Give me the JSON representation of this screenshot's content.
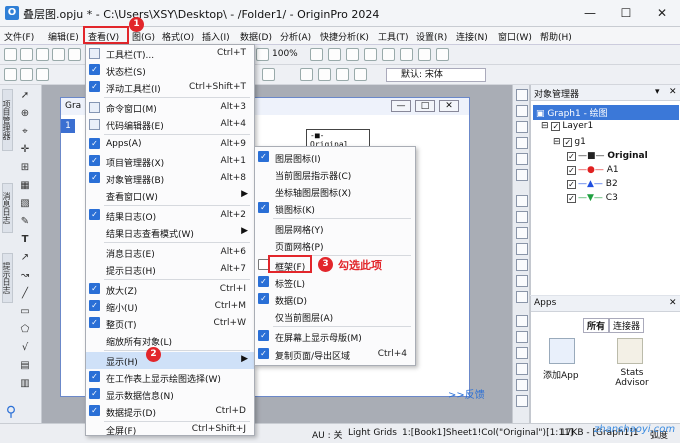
{
  "window": {
    "title": "叠层图.opju * - C:\\Users\\XSY\\Desktop\\ - /Folder1/ - OriginPro 2024",
    "min": "—",
    "max": "☐",
    "close": "✕"
  },
  "menubar": [
    "文件(F)",
    "编辑(E)",
    "查看(V)",
    "图(G)",
    "格式(O)",
    "插入(I)",
    "数据(D)",
    "分析(A)",
    "快捷分析(K)",
    "工具(T)",
    "设置(R)",
    "连接(N)",
    "窗口(W)",
    "帮助(H)"
  ],
  "toolbar": {
    "zoom": "100%",
    "font": "默认: 宋体"
  },
  "left_tabs": [
    "项目管理器",
    "消息日志",
    "提示日志"
  ],
  "graph_window": {
    "title": "Gra",
    "layer": "1",
    "legend": [
      "Original",
      "A1"
    ]
  },
  "feedback": ">>反馈",
  "view_menu": [
    {
      "label": "工具栏(T)...",
      "shortcut": "Ctrl+T"
    },
    {
      "label": "状态栏(S)",
      "checked": true
    },
    {
      "label": "浮动工具栏(I)",
      "shortcut": "Ctrl+Shift+T",
      "checked": true
    },
    {
      "label": "命令窗口(M)",
      "shortcut": "Alt+3"
    },
    {
      "label": "代码编辑器(E)",
      "shortcut": "Alt+4"
    },
    {
      "label": "Apps(A)",
      "shortcut": "Alt+9",
      "checked": true
    },
    {
      "label": "项目管理器(X)",
      "shortcut": "Alt+1",
      "checked": true
    },
    {
      "label": "对象管理器(B)",
      "shortcut": "Alt+8",
      "checked": true
    },
    {
      "label": "查看窗口(W)",
      "submenu": true
    },
    {
      "label": "结果日志(O)",
      "shortcut": "Alt+2",
      "checked": true
    },
    {
      "label": "结果日志查看模式(W)",
      "submenu": true
    },
    {
      "label": "消息日志(E)",
      "shortcut": "Alt+6"
    },
    {
      "label": "提示日志(H)",
      "shortcut": "Alt+7"
    },
    {
      "label": "放大(Z)",
      "shortcut": "Ctrl+I",
      "checked": true
    },
    {
      "label": "缩小(U)",
      "shortcut": "Ctrl+M",
      "checked": true
    },
    {
      "label": "整页(T)",
      "shortcut": "Ctrl+W",
      "checked": true
    },
    {
      "label": "缩放所有对象(L)"
    },
    {
      "label": "显示(H)",
      "submenu": true,
      "highlight": true
    },
    {
      "label": "在工作表上显示绘图选择(W)",
      "checked": true
    },
    {
      "label": "显示数据信息(N)",
      "checked": true
    },
    {
      "label": "数据提示(D)",
      "shortcut": "Ctrl+D",
      "checked": true
    },
    {
      "label": "全屏(F)",
      "shortcut": "Ctrl+Shift+J"
    }
  ],
  "show_submenu": [
    {
      "label": "图层图标(I)",
      "checked": true
    },
    {
      "label": "当前图层指示器(C)"
    },
    {
      "label": "坐标轴图层图标(X)"
    },
    {
      "label": "锁图标(K)",
      "checked": true
    },
    {
      "label": "图层网格(Y)"
    },
    {
      "label": "页面网格(P)"
    },
    {
      "label": "框架(F)",
      "checked": true
    },
    {
      "label": "标签(L)",
      "checked": true
    },
    {
      "label": "数据(D)",
      "checked": true
    },
    {
      "label": "仅当前图层(A)"
    },
    {
      "label": "在屏幕上显示母版(M)",
      "checked": true
    },
    {
      "label": "复制页面/导出区域",
      "shortcut": "Ctrl+4",
      "checked": true
    }
  ],
  "annotation": {
    "step1": "1",
    "step2": "2",
    "step3": "3",
    "text": "勾选此项"
  },
  "object_manager": {
    "title": "对象管理器",
    "graph": "Graph1 - 绘图",
    "layer": "Layer1",
    "group": "g1",
    "items": [
      {
        "name": "Original",
        "color": "#222222",
        "marker": "square"
      },
      {
        "name": "A1",
        "color": "#e02020",
        "marker": "circle"
      },
      {
        "name": "B2",
        "color": "#2050e0",
        "marker": "triangle-up"
      },
      {
        "name": "C3",
        "color": "#20a040",
        "marker": "triangle-down"
      }
    ]
  },
  "apps": {
    "title": "Apps",
    "tabs": [
      "所有",
      "连接器"
    ],
    "items": [
      "添加App",
      "Stats Advisor"
    ]
  },
  "status": {
    "au": "AU : 关",
    "grid": "Light Grids",
    "cell": "1:[Book1]Sheet1!Col(\"Original\")[1:11]",
    "size": "17KB - [Graph1]1",
    "unit": "弧度"
  },
  "watermark": "zhanshaoyi.com"
}
